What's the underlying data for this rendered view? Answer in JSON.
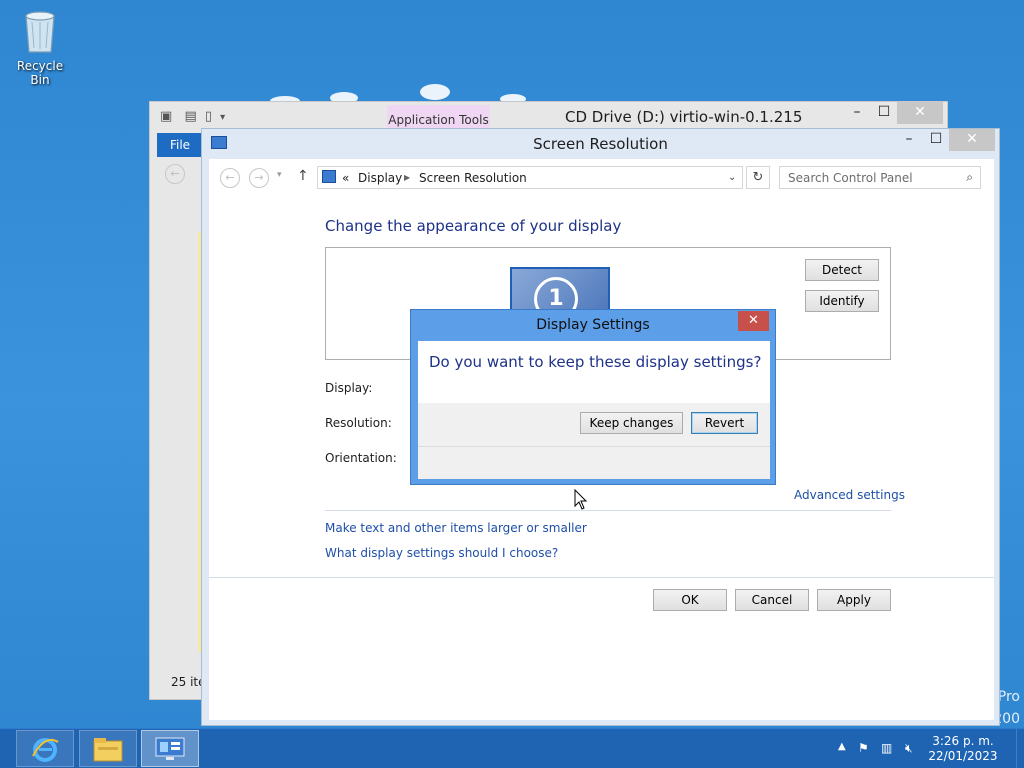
{
  "desktop": {
    "recycle_bin_label": "Recycle Bin",
    "watermark_line1": "Pro",
    "watermark_line2": "200"
  },
  "explorer_window": {
    "title": "CD Drive (D:) virtio-win-0.1.215",
    "context_tab": "Application Tools",
    "file_tab": "File",
    "status": "25 ite"
  },
  "screen_resolution_window": {
    "title": "Screen Resolution",
    "breadcrumb": {
      "prefix": "«",
      "items": [
        "Display",
        "Screen Resolution"
      ]
    },
    "search": {
      "placeholder": "Search Control Panel"
    },
    "heading": "Change the appearance of your display",
    "monitor_number": "1",
    "detect_label": "Detect",
    "identify_label": "Identify",
    "display_label": "Display:",
    "resolution_label": "Resolution:",
    "orientation_label": "Orientation:",
    "advanced_link": "Advanced settings",
    "link_text_size": "Make text and other items larger or smaller",
    "link_choose": "What display settings should I choose?",
    "ok_label": "OK",
    "cancel_label": "Cancel",
    "apply_label": "Apply"
  },
  "dialog": {
    "title": "Display Settings",
    "message": "Do you want to keep these display settings?",
    "keep_label": "Keep changes",
    "revert_label": "Revert"
  },
  "taskbar": {
    "time": "3:26 p. m.",
    "date": "22/01/2023"
  },
  "colors": {
    "desktop": "#2f86d1",
    "taskbar": "#1e64b3",
    "dialog_frame": "#5c9ee7",
    "window_frame": "#dfe9f5",
    "link": "#1e4fa8",
    "heading": "#1e3287",
    "close_button": "#c7504a",
    "context_tab": "#efd6f2"
  },
  "icons": [
    "recycle-bin-icon",
    "internet-explorer-icon",
    "file-explorer-icon",
    "control-panel-icon",
    "flag-icon",
    "network-icon",
    "volume-muted-icon",
    "refresh-icon",
    "search-icon",
    "up-arrow-icon",
    "back-icon",
    "forward-icon"
  ]
}
